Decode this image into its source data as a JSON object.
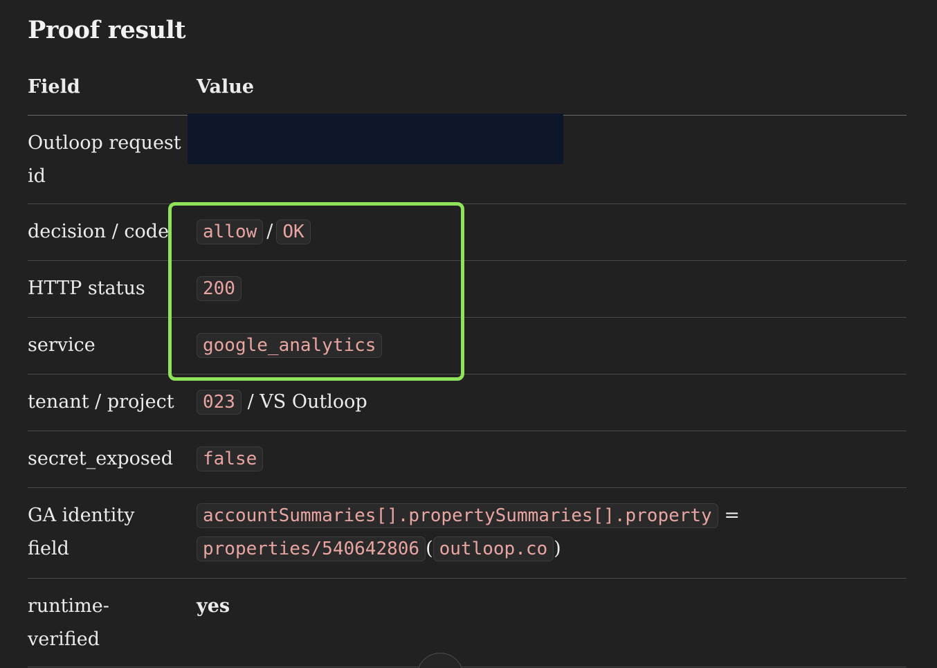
{
  "title": "Proof result",
  "table": {
    "headers": {
      "field": "Field",
      "value": "Value"
    },
    "rows": {
      "request_id": {
        "field_line1": "Outloop request",
        "field_line2": "id"
      },
      "decision": {
        "field": "decision / code",
        "decision": "allow",
        "sep": "/",
        "code": "OK"
      },
      "http_status": {
        "field": "HTTP status",
        "value": "200"
      },
      "service": {
        "field": "service",
        "value": "google_analytics"
      },
      "tenant": {
        "field": "tenant / project",
        "tenant": "023",
        "project": "/ VS Outloop"
      },
      "secret": {
        "field": "secret_exposed",
        "value": "false"
      },
      "ga_identity": {
        "field_line1": "GA identity",
        "field_line2": "field",
        "path": "accountSummaries[].propertySummaries[].property",
        "equals": "=",
        "property": "properties/540642806",
        "open_paren": "(",
        "domain": "outloop.co",
        "close_paren": ")"
      },
      "runtime": {
        "field_line1": "runtime-",
        "field_line2": "verified",
        "value": "yes"
      }
    }
  },
  "colors": {
    "background": "#212121",
    "highlight_border": "#8fe35a",
    "redaction": "#0e1729",
    "code_text": "#e8a5a2"
  }
}
